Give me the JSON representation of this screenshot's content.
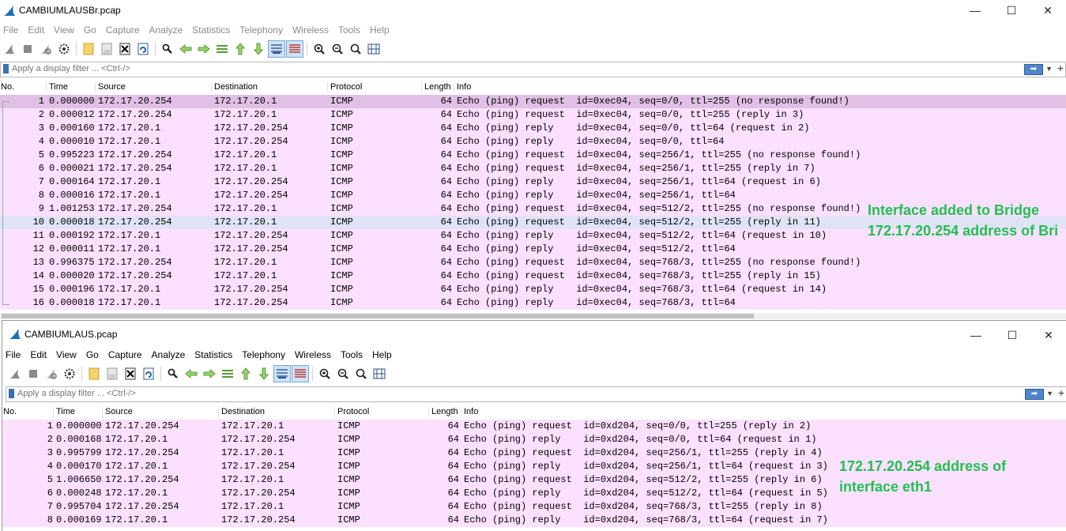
{
  "window1": {
    "title": "CAMBIUMLAUSBr.pcap",
    "menu": [
      "File",
      "Edit",
      "View",
      "Go",
      "Capture",
      "Analyze",
      "Statistics",
      "Telephony",
      "Wireless",
      "Tools",
      "Help"
    ],
    "filter_placeholder": "Apply a display filter ... <Ctrl-/>",
    "columns": [
      "No.",
      "Time",
      "Source",
      "Destination",
      "Protocol",
      "Length",
      "Info"
    ],
    "packets": [
      {
        "no": "1",
        "time": "0.000000",
        "src": "172.17.20.254",
        "dst": "172.17.20.1",
        "proto": "ICMP",
        "len": "64",
        "info": "Echo (ping) request  id=0xec04, seq=0/0, ttl=255 (no response found!)"
      },
      {
        "no": "2",
        "time": "0.000012",
        "src": "172.17.20.254",
        "dst": "172.17.20.1",
        "proto": "ICMP",
        "len": "64",
        "info": "Echo (ping) request  id=0xec04, seq=0/0, ttl=255 (reply in 3)"
      },
      {
        "no": "3",
        "time": "0.000160",
        "src": "172.17.20.1",
        "dst": "172.17.20.254",
        "proto": "ICMP",
        "len": "64",
        "info": "Echo (ping) reply    id=0xec04, seq=0/0, ttl=64 (request in 2)"
      },
      {
        "no": "4",
        "time": "0.000010",
        "src": "172.17.20.1",
        "dst": "172.17.20.254",
        "proto": "ICMP",
        "len": "64",
        "info": "Echo (ping) reply    id=0xec04, seq=0/0, ttl=64"
      },
      {
        "no": "5",
        "time": "0.995223",
        "src": "172.17.20.254",
        "dst": "172.17.20.1",
        "proto": "ICMP",
        "len": "64",
        "info": "Echo (ping) request  id=0xec04, seq=256/1, ttl=255 (no response found!)"
      },
      {
        "no": "6",
        "time": "0.000021",
        "src": "172.17.20.254",
        "dst": "172.17.20.1",
        "proto": "ICMP",
        "len": "64",
        "info": "Echo (ping) request  id=0xec04, seq=256/1, ttl=255 (reply in 7)"
      },
      {
        "no": "7",
        "time": "0.000164",
        "src": "172.17.20.1",
        "dst": "172.17.20.254",
        "proto": "ICMP",
        "len": "64",
        "info": "Echo (ping) reply    id=0xec04, seq=256/1, ttl=64 (request in 6)"
      },
      {
        "no": "8",
        "time": "0.000016",
        "src": "172.17.20.1",
        "dst": "172.17.20.254",
        "proto": "ICMP",
        "len": "64",
        "info": "Echo (ping) reply    id=0xec04, seq=256/1, ttl=64"
      },
      {
        "no": "9",
        "time": "1.001253",
        "src": "172.17.20.254",
        "dst": "172.17.20.1",
        "proto": "ICMP",
        "len": "64",
        "info": "Echo (ping) request  id=0xec04, seq=512/2, ttl=255 (no response found!)"
      },
      {
        "no": "10",
        "time": "0.000018",
        "src": "172.17.20.254",
        "dst": "172.17.20.1",
        "proto": "ICMP",
        "len": "64",
        "info": "Echo (ping) request  id=0xec04, seq=512/2, ttl=255 (reply in 11)"
      },
      {
        "no": "11",
        "time": "0.000192",
        "src": "172.17.20.1",
        "dst": "172.17.20.254",
        "proto": "ICMP",
        "len": "64",
        "info": "Echo (ping) reply    id=0xec04, seq=512/2, ttl=64 (request in 10)"
      },
      {
        "no": "12",
        "time": "0.000011",
        "src": "172.17.20.1",
        "dst": "172.17.20.254",
        "proto": "ICMP",
        "len": "64",
        "info": "Echo (ping) reply    id=0xec04, seq=512/2, ttl=64"
      },
      {
        "no": "13",
        "time": "0.996375",
        "src": "172.17.20.254",
        "dst": "172.17.20.1",
        "proto": "ICMP",
        "len": "64",
        "info": "Echo (ping) request  id=0xec04, seq=768/3, ttl=255 (no response found!)"
      },
      {
        "no": "14",
        "time": "0.000020",
        "src": "172.17.20.254",
        "dst": "172.17.20.1",
        "proto": "ICMP",
        "len": "64",
        "info": "Echo (ping) request  id=0xec04, seq=768/3, ttl=255 (reply in 15)"
      },
      {
        "no": "15",
        "time": "0.000196",
        "src": "172.17.20.1",
        "dst": "172.17.20.254",
        "proto": "ICMP",
        "len": "64",
        "info": "Echo (ping) reply    id=0xec04, seq=768/3, ttl=64 (request in 14)"
      },
      {
        "no": "16",
        "time": "0.000018",
        "src": "172.17.20.1",
        "dst": "172.17.20.254",
        "proto": "ICMP",
        "len": "64",
        "info": "Echo (ping) reply    id=0xec04, seq=768/3, ttl=64"
      }
    ],
    "annotation": [
      "Interface added to Bridge",
      "172.17.20.254 address of Bri"
    ]
  },
  "window2": {
    "title": "CAMBIUMLAUS.pcap",
    "menu": [
      "File",
      "Edit",
      "View",
      "Go",
      "Capture",
      "Analyze",
      "Statistics",
      "Telephony",
      "Wireless",
      "Tools",
      "Help"
    ],
    "filter_placeholder": "Apply a display filter ... <Ctrl-/>",
    "columns": [
      "No.",
      "Time",
      "Source",
      "Destination",
      "Protocol",
      "Length",
      "Info"
    ],
    "packets": [
      {
        "no": "1",
        "time": "0.000000",
        "src": "172.17.20.254",
        "dst": "172.17.20.1",
        "proto": "ICMP",
        "len": "64",
        "info": "Echo (ping) request  id=0xd204, seq=0/0, ttl=255 (reply in 2)"
      },
      {
        "no": "2",
        "time": "0.000168",
        "src": "172.17.20.1",
        "dst": "172.17.20.254",
        "proto": "ICMP",
        "len": "64",
        "info": "Echo (ping) reply    id=0xd204, seq=0/0, ttl=64 (request in 1)"
      },
      {
        "no": "3",
        "time": "0.995799",
        "src": "172.17.20.254",
        "dst": "172.17.20.1",
        "proto": "ICMP",
        "len": "64",
        "info": "Echo (ping) request  id=0xd204, seq=256/1, ttl=255 (reply in 4)"
      },
      {
        "no": "4",
        "time": "0.000170",
        "src": "172.17.20.1",
        "dst": "172.17.20.254",
        "proto": "ICMP",
        "len": "64",
        "info": "Echo (ping) reply    id=0xd204, seq=256/1, ttl=64 (request in 3)"
      },
      {
        "no": "5",
        "time": "1.006650",
        "src": "172.17.20.254",
        "dst": "172.17.20.1",
        "proto": "ICMP",
        "len": "64",
        "info": "Echo (ping) request  id=0xd204, seq=512/2, ttl=255 (reply in 6)"
      },
      {
        "no": "6",
        "time": "0.000248",
        "src": "172.17.20.1",
        "dst": "172.17.20.254",
        "proto": "ICMP",
        "len": "64",
        "info": "Echo (ping) reply    id=0xd204, seq=512/2, ttl=64 (request in 5)"
      },
      {
        "no": "7",
        "time": "0.995704",
        "src": "172.17.20.254",
        "dst": "172.17.20.1",
        "proto": "ICMP",
        "len": "64",
        "info": "Echo (ping) request  id=0xd204, seq=768/3, ttl=255 (reply in 8)"
      },
      {
        "no": "8",
        "time": "0.000169",
        "src": "172.17.20.1",
        "dst": "172.17.20.254",
        "proto": "ICMP",
        "len": "64",
        "info": "Echo (ping) reply    id=0xd204, seq=768/3, ttl=64 (request in 7)"
      }
    ],
    "annotation": [
      "172.17.20.254 address of",
      "interface eth1"
    ]
  },
  "window_controls": {
    "minimize": "—",
    "maximize": "☐",
    "close": "✕"
  },
  "icons": [
    "shark-fin-start-icon",
    "stop-icon",
    "restart-icon",
    "options-gear-icon",
    "open-file-icon",
    "save-file-icon",
    "close-file-icon",
    "reload-icon",
    "find-packet-icon",
    "go-back-icon",
    "go-forward-icon",
    "go-to-packet-icon",
    "first-packet-icon",
    "last-packet-icon",
    "autoscroll-icon",
    "colorize-icon",
    "zoom-in-icon",
    "zoom-out-icon",
    "zoom-normal-icon",
    "resize-columns-icon"
  ],
  "colors": {
    "row_icmp": "#fce0ff",
    "row_selected": "#e0c0e4",
    "row_hover": "#dfe3f5",
    "annotation": "#20c050"
  }
}
